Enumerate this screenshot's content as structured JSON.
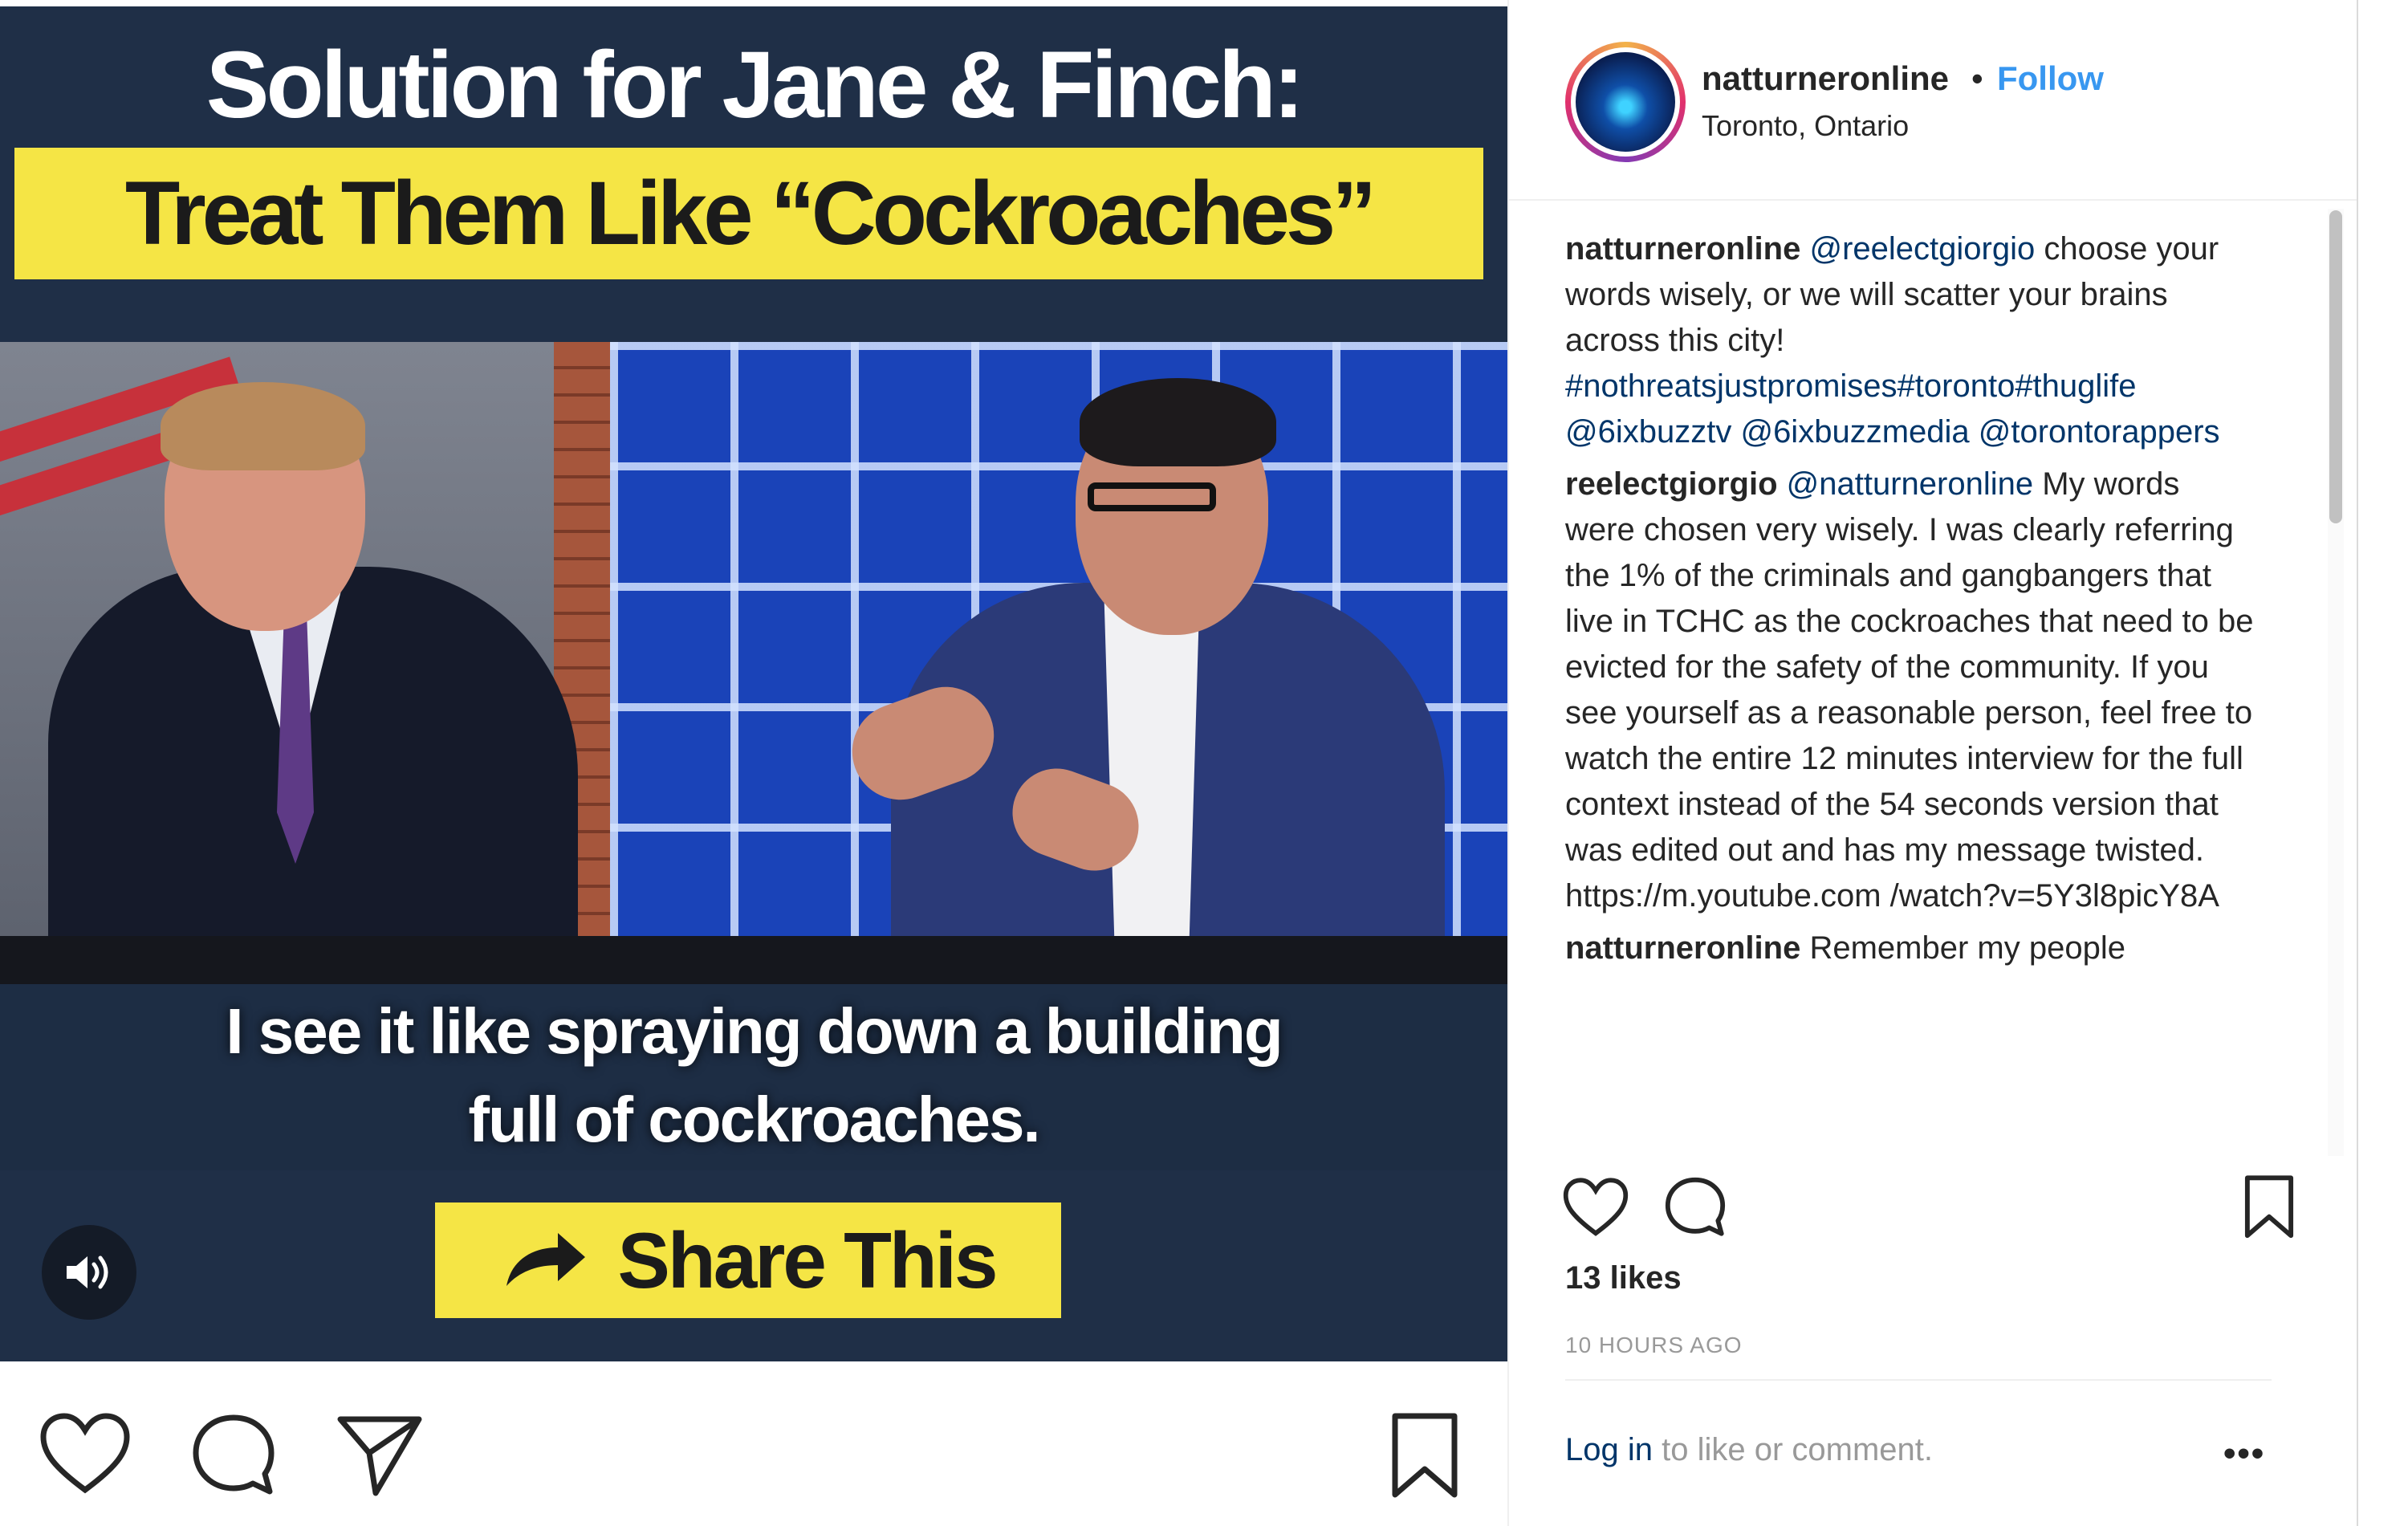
{
  "media": {
    "headline_line1": "Solution for Jane & Finch:",
    "headline_line2": "Treat Them Like “Cockroaches”",
    "subtitle_line1": "I see it like spraying down a building",
    "subtitle_line2": "full of cockroaches.",
    "share_label": "Share This",
    "sound_icon": "speaker-icon",
    "headline_bg": "#f5e545"
  },
  "media_actions": {
    "icons": [
      "heart-icon",
      "comment-icon",
      "share-icon",
      "bookmark-icon"
    ]
  },
  "post": {
    "username": "natturneronline",
    "separator": "•",
    "follow_label": "Follow",
    "location": "Toronto, Ontario",
    "accent_color": "#3897f0"
  },
  "comments": [
    {
      "user": "natturneronline",
      "mention": "@reelectgiorgio",
      "text": " choose your words wisely, or we will scatter your brains across this city! ",
      "tags": "#nothreatsjustpromises#toronto#thuglife @6ixbuzztv @6ixbuzzmedia @torontorappers"
    },
    {
      "user": "reelectgiorgio",
      "mention": "@natturneronline",
      "text": " My words were chosen very wisely. I was clearly referring the 1% of the criminals and gangbangers that live in TCHC as the cockroaches that need to be evicted for the safety of the community. If you see yourself as a reasonable person, feel free to watch the entire 12 minutes interview for the full context instead of the 54 seconds version that was edited out and has my message twisted. https://m.youtube.com /watch?v=5Y3l8picY8A",
      "tags": ""
    },
    {
      "user": "natturneronline",
      "mention": "",
      "text": " Remember my people",
      "tags": ""
    }
  ],
  "panel_actions": {
    "likes": "13 likes",
    "timestamp": "10 HOURS AGO",
    "login_link": "Log in",
    "login_rest": " to like or comment.",
    "more_label": "•••"
  }
}
